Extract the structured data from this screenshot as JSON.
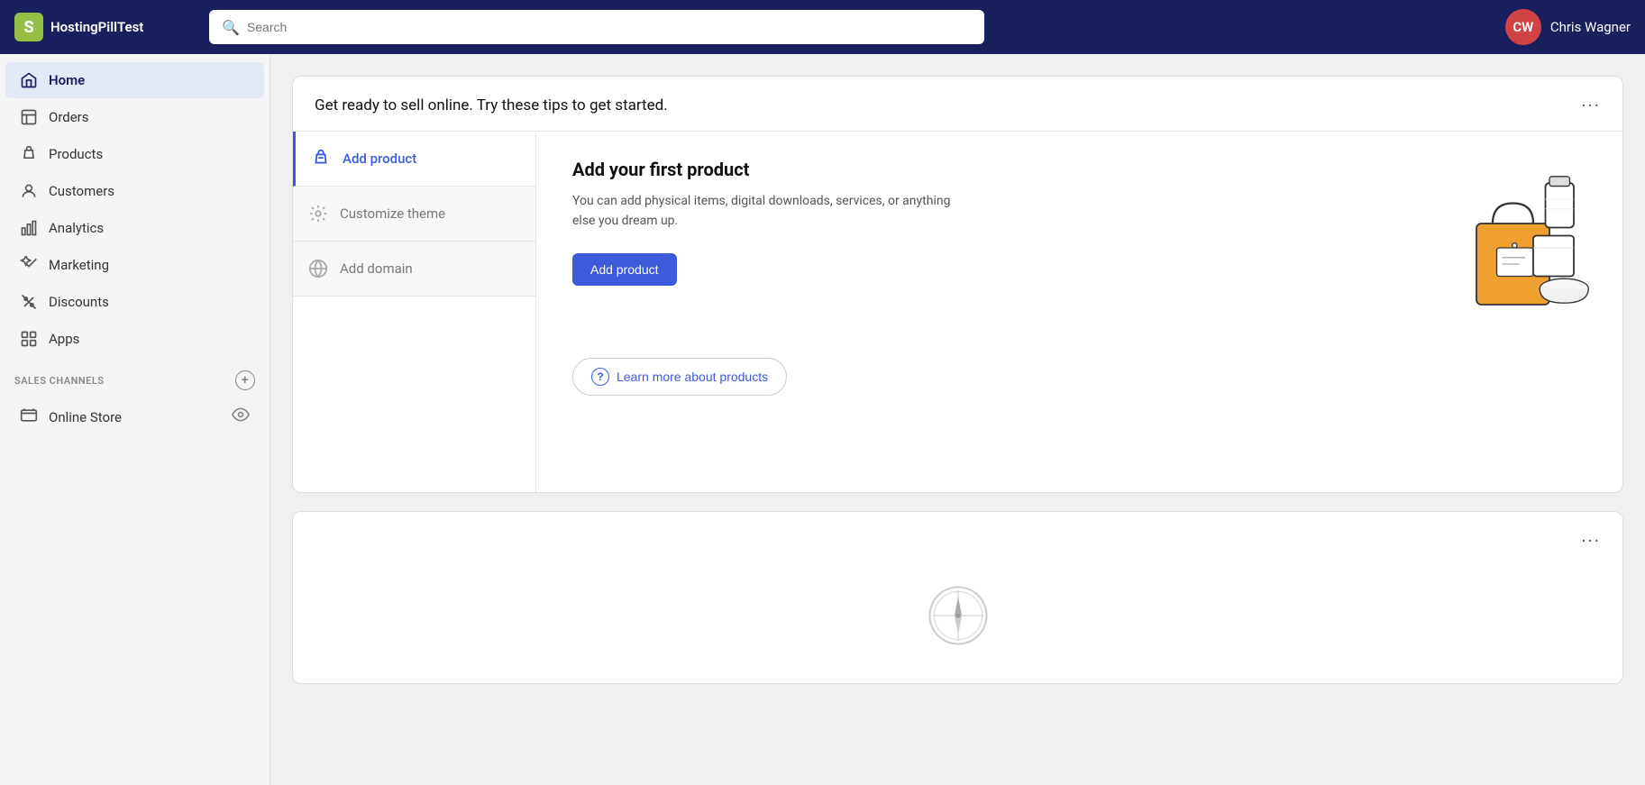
{
  "app": {
    "name": "HostingPillTest",
    "logo_letter": "S"
  },
  "header": {
    "search_placeholder": "Search",
    "user_initials": "CW",
    "user_name": "Chris Wagner"
  },
  "sidebar": {
    "nav_items": [
      {
        "id": "home",
        "label": "Home",
        "icon": "home-icon",
        "active": true
      },
      {
        "id": "orders",
        "label": "Orders",
        "icon": "orders-icon",
        "active": false
      },
      {
        "id": "products",
        "label": "Products",
        "icon": "products-icon",
        "active": false
      },
      {
        "id": "customers",
        "label": "Customers",
        "icon": "customers-icon",
        "active": false
      },
      {
        "id": "analytics",
        "label": "Analytics",
        "icon": "analytics-icon",
        "active": false
      },
      {
        "id": "marketing",
        "label": "Marketing",
        "icon": "marketing-icon",
        "active": false
      },
      {
        "id": "discounts",
        "label": "Discounts",
        "icon": "discounts-icon",
        "active": false
      },
      {
        "id": "apps",
        "label": "Apps",
        "icon": "apps-icon",
        "active": false
      }
    ],
    "sales_channels_label": "SALES CHANNELS",
    "online_store_label": "Online Store"
  },
  "main": {
    "card1": {
      "title": "Get ready to sell online. Try these tips to get started.",
      "more_icon": "···",
      "steps": [
        {
          "id": "add-product",
          "label": "Add product",
          "active": true
        },
        {
          "id": "customize-theme",
          "label": "Customize theme",
          "active": false
        },
        {
          "id": "add-domain",
          "label": "Add domain",
          "active": false
        }
      ],
      "active_step": {
        "title": "Add your first product",
        "description": "You can add physical items, digital downloads, services, or anything else you dream up.",
        "button_label": "Add product",
        "learn_more_label": "Learn more about products"
      }
    },
    "card2": {
      "more_icon": "···"
    }
  }
}
